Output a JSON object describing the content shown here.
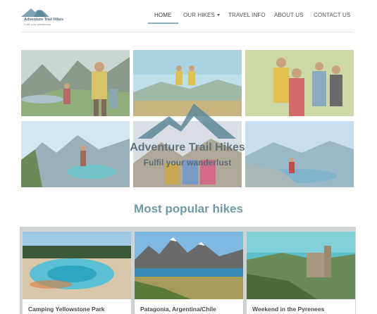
{
  "brand": {
    "name": "Adventure Trail Hikes",
    "tagline": "Fulfil your wanderlust"
  },
  "nav": {
    "items": [
      {
        "label": "HOME",
        "active": true
      },
      {
        "label": "OUR HIKES",
        "has_dropdown": true
      },
      {
        "label": "TRAVEL INFO"
      },
      {
        "label": "ABOUT US"
      },
      {
        "label": "CONTACT US"
      }
    ]
  },
  "hero": {
    "title": "Adventure Trail Hikes",
    "subtitle": "Fulfil your wanderlust"
  },
  "popular": {
    "heading": "Most popular hikes",
    "cards": [
      {
        "title": "Camping Yellowstone Park"
      },
      {
        "title": "Patagonia, Argentina/Chile"
      },
      {
        "title": "Weekend in the Pyrenees"
      }
    ]
  },
  "colors": {
    "accent": "#6f9aa5",
    "nav_text": "#555555",
    "card_bg": "#cfd3d4"
  }
}
